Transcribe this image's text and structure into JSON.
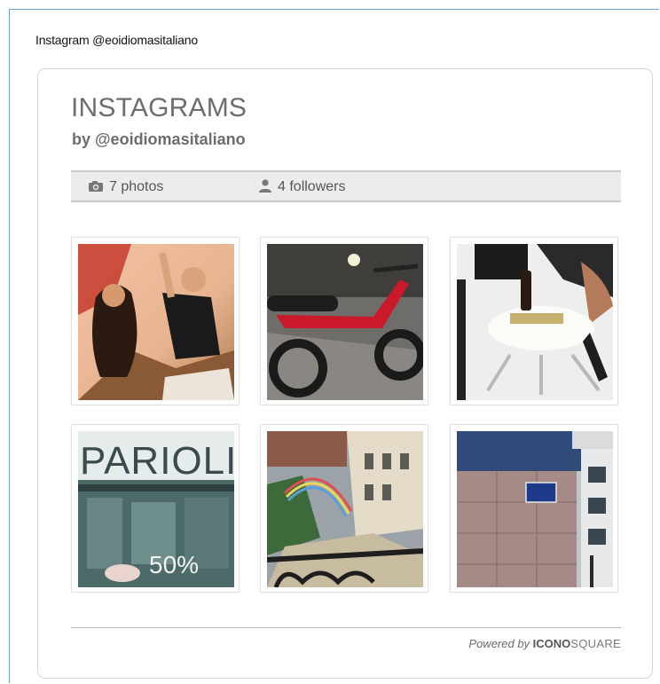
{
  "widget": {
    "title": "Instagram @eoidiomasitaliano"
  },
  "header": {
    "title": "INSTAGRAMS",
    "byline": "by @eoidiomasitaliano"
  },
  "stats": {
    "photos_label": "7 photos",
    "followers_label": "4 followers",
    "photos_icon": "camera-icon",
    "followers_icon": "user-icon"
  },
  "photos": [
    {
      "name": "photo-dancers"
    },
    {
      "name": "photo-red-scooter"
    },
    {
      "name": "photo-table-bottle"
    },
    {
      "name": "photo-parioli-shop",
      "sign_text": "PARIOLI",
      "sale_text": "50%"
    },
    {
      "name": "photo-rainbow-street"
    },
    {
      "name": "photo-street-sign"
    }
  ],
  "footer": {
    "powered_prefix": "Powered by ",
    "brand_bold": "ICONO",
    "brand_light": "SQUARE"
  }
}
